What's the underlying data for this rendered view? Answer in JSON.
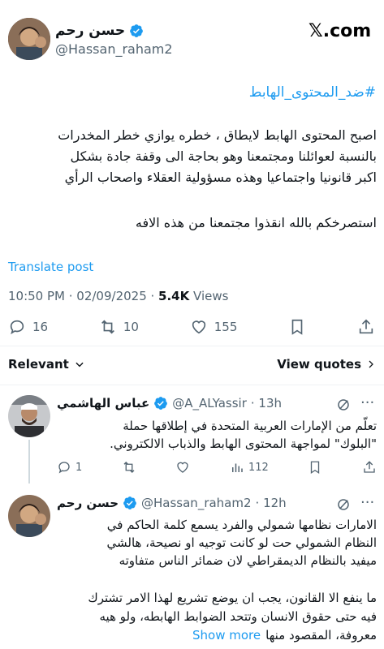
{
  "brand": {
    "logo_text": "𝕏.com"
  },
  "post": {
    "display_name": "حسن رحم",
    "handle": "@Hassan_raham2",
    "hashtag": "#ضد_المحتوى_الهابط",
    "body_lines": [
      "اصبح المحتوى الهابط لايطاق ، خطره يوازي خطر المخدرات",
      "بالنسبة لعوائلنا ومجتمعنا وهو بحاجة الى وقفة جادة بشكل",
      "اكبر قانونيا واجتماعيا وهذه مسؤولية العقلاء واصحاب الرأي"
    ],
    "closing_line": "استصرخكم بالله انقذوا مجتمعنا من هذه الافه",
    "translate": "Translate post",
    "time": "10:50 PM · 02/09/2025 · ",
    "views_count": "5.4K",
    "views_label": " Views",
    "replies": "16",
    "reposts": "10",
    "likes": "155"
  },
  "sort": {
    "relevant": "Relevant",
    "view_quotes": "View quotes"
  },
  "reply1": {
    "display_name": "عباس الهاشمي",
    "handle": "@A_ALYassir",
    "time": "· 13h",
    "lines": [
      "تعلّم من الإمارات العربية المتحدة في إطلاقها حملة",
      "\"البلوك\" لمواجهة المحتوى الهابط والذباب الالكتروني."
    ],
    "replies": "1",
    "views": "112"
  },
  "reply2": {
    "display_name": "حسن رحم",
    "handle": "@Hassan_raham2",
    "time": "· 12h",
    "lines": [
      "الامارات نظامها شمولي والفرد يسمع كلمة الحاكم في",
      "النظام الشمولي حت لو كانت توجيه او نصيحة، هالشي",
      "ميفيد بالنظام الديمقراطي لان ضمائر الناس متفاوته"
    ],
    "lines2": [
      "ما ينفع الا القانون، يجب ان يوضع تشريع لهذا الامر تشترك",
      "فيه حتى حقوق الانسان وتتحد الضوابط الهابطه، ولو هيه",
      "معروفة، المقصود منها"
    ],
    "show_more": "Show more"
  },
  "colors": {
    "accent": "#1d9bf0",
    "muted": "#536471",
    "text": "#0f1419"
  }
}
